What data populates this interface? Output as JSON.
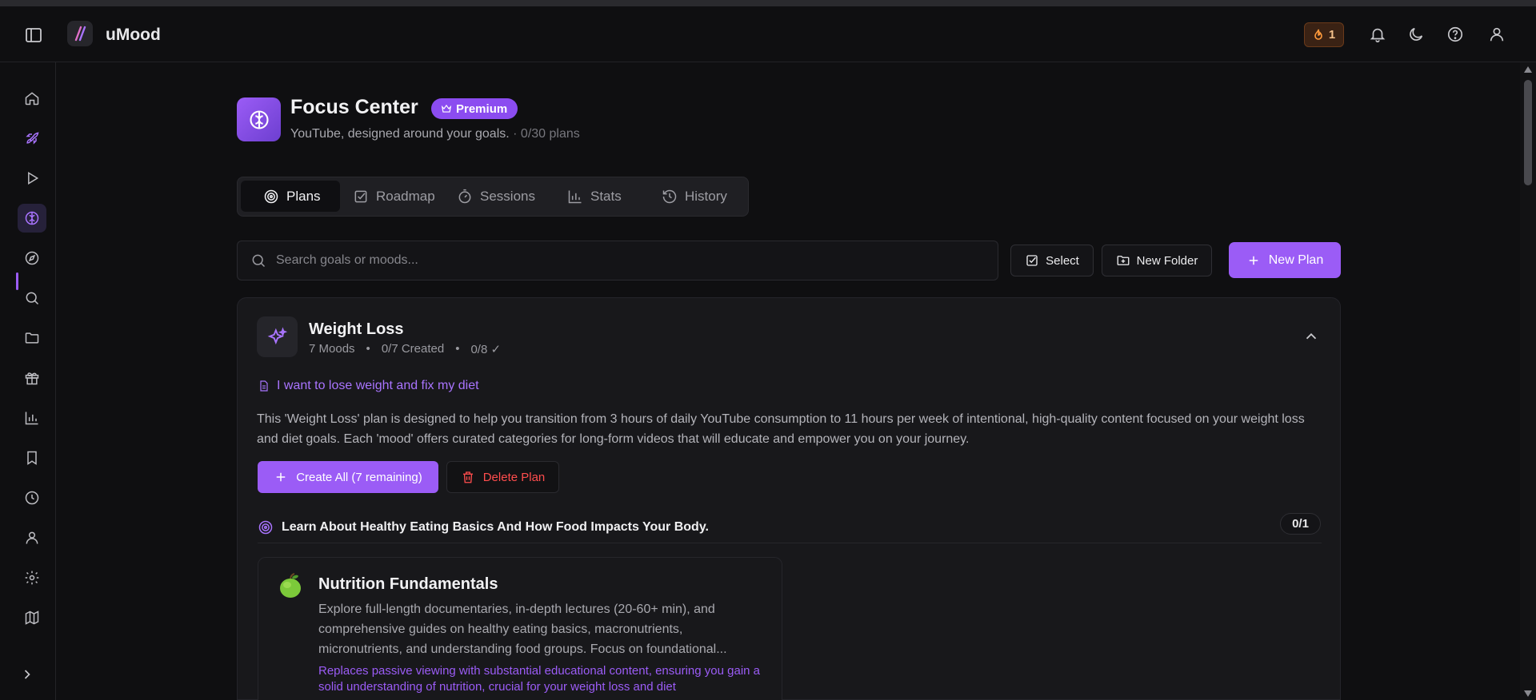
{
  "app": {
    "name": "uMood",
    "streak_count": "1"
  },
  "header": {
    "icons": [
      "sidebar-toggle-icon",
      "flame-icon",
      "bell-icon",
      "moon-icon",
      "help-icon",
      "user-icon"
    ]
  },
  "sidebar": {
    "items": [
      {
        "name": "home",
        "icon": "home-icon"
      },
      {
        "name": "launch",
        "icon": "rocket-icon"
      },
      {
        "name": "play",
        "icon": "play-icon"
      },
      {
        "name": "focus",
        "icon": "brain-icon",
        "active": true
      },
      {
        "name": "explore",
        "icon": "compass-icon"
      },
      {
        "name": "search",
        "icon": "search-icon"
      },
      {
        "name": "folders",
        "icon": "folder-icon"
      },
      {
        "name": "rewards",
        "icon": "gift-icon"
      },
      {
        "name": "stats",
        "icon": "bar-chart-icon"
      },
      {
        "name": "saved",
        "icon": "bookmark-icon"
      },
      {
        "name": "history",
        "icon": "clock-icon"
      },
      {
        "name": "profile",
        "icon": "user-icon"
      },
      {
        "name": "settings",
        "icon": "gear-icon"
      },
      {
        "name": "map",
        "icon": "map-icon"
      }
    ]
  },
  "page": {
    "title": "Focus Center",
    "badge": "Premium",
    "subtitle": "YouTube, designed around your goals.",
    "plans_count": "· 0/30 plans"
  },
  "tabs": [
    {
      "label": "Plans",
      "active": true
    },
    {
      "label": "Roadmap"
    },
    {
      "label": "Sessions"
    },
    {
      "label": "Stats"
    },
    {
      "label": "History"
    }
  ],
  "search": {
    "placeholder": "Search goals or moods..."
  },
  "toolbar": {
    "select_label": "Select",
    "new_folder_label": "New Folder",
    "new_plan_label": "New Plan"
  },
  "plan": {
    "title": "Weight Loss",
    "meta_moods": "7 Moods",
    "meta_dot": "•",
    "meta_created": "0/7 Created",
    "meta_done": "0/8 ✓",
    "goal": "I want to lose weight and fix my diet",
    "description": "This 'Weight Loss' plan is designed to help you transition from 3 hours of daily YouTube consumption to 11 hours per week of intentional, high-quality content focused on your weight loss and diet goals. Each 'mood' offers curated categories for long-form videos that will educate and empower you on your journey.",
    "create_all_label": "Create All (7 remaining)",
    "delete_label": "Delete Plan"
  },
  "section": {
    "title": "Learn About Healthy Eating Basics And How Food Impacts Your Body.",
    "count": "0/1"
  },
  "mood": {
    "title": "Nutrition Fundamentals",
    "description": "Explore full-length documentaries, in-depth lectures (20-60+ min), and comprehensive guides on healthy eating basics, macronutrients, micronutrients, and understanding food groups. Focus on foundational...",
    "note": "Replaces passive viewing with substantial educational content, ensuring you gain a solid understanding of nutrition, crucial for your weight loss and diet"
  },
  "colors": {
    "accent": "#9b5cf6",
    "danger": "#ff4d4d",
    "background": "#0f0f11"
  }
}
